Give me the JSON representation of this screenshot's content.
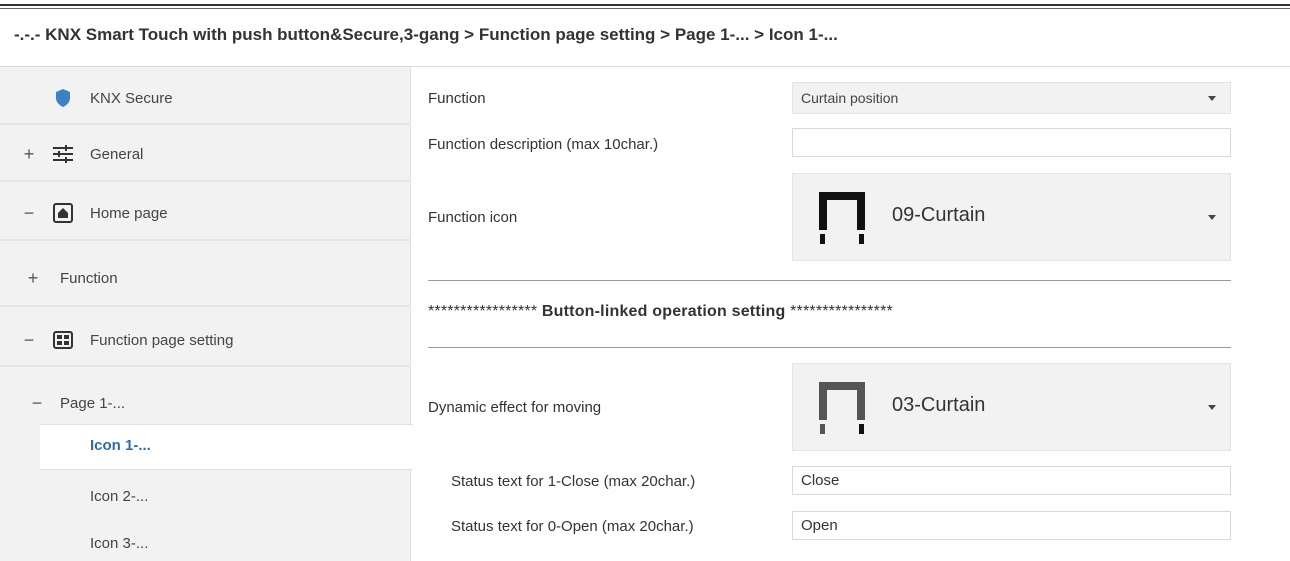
{
  "breadcrumb": "-.-.- KNX Smart Touch with push button&Secure,3-gang > Function page setting > Page 1-... > Icon 1-...",
  "sidebar": {
    "items": [
      {
        "label": "KNX Secure",
        "expander": "",
        "icon": "shield-icon"
      },
      {
        "label": "General",
        "expander": "+",
        "icon": "sliders-icon"
      },
      {
        "label": "Home page",
        "expander": "−",
        "icon": "home-icon"
      },
      {
        "label": "Function",
        "expander": "+",
        "icon": ""
      },
      {
        "label": "Function page setting",
        "expander": "−",
        "icon": "grid-icon"
      },
      {
        "label": "Page 1-...",
        "expander": "−",
        "icon": ""
      },
      {
        "label": "Icon 1-...",
        "expander": "",
        "icon": ""
      },
      {
        "label": "Icon 2-...",
        "expander": "",
        "icon": ""
      },
      {
        "label": "Icon 3-...",
        "expander": "",
        "icon": ""
      }
    ]
  },
  "params": {
    "function": {
      "label": "Function",
      "value": "Curtain position"
    },
    "description": {
      "label": "Function description (max 10char.)",
      "value": ""
    },
    "icon": {
      "label": "Function icon",
      "value": "09-Curtain"
    },
    "section_title_prefix": "*****************",
    "section_title": "Button-linked operation setting",
    "section_title_suffix": "****************",
    "dynamic": {
      "label": "Dynamic effect for moving",
      "value": "03-Curtain"
    },
    "status1": {
      "label": "Status text for 1-Close (max 20char.)",
      "value": "Close"
    },
    "status0": {
      "label": "Status text for 0-Open (max 20char.)",
      "value": "Open"
    }
  },
  "colors": {
    "accent": "#2b6cb0",
    "shield": "#3b82c4",
    "sidebar_bg": "#f2f2f2"
  }
}
